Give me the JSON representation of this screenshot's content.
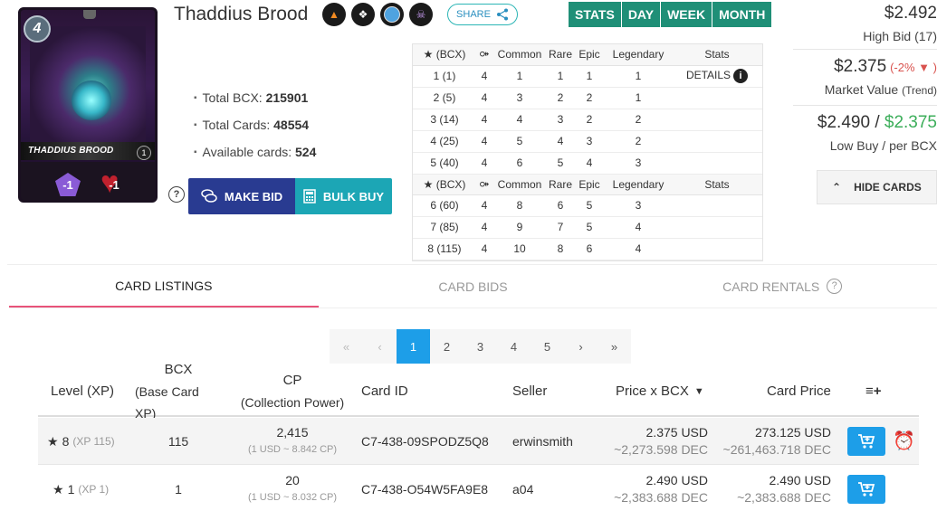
{
  "card": {
    "name": "Thaddius Brood",
    "mana": "4",
    "card_name_banner": "THADDIUS BROOD",
    "level": "1",
    "magic": "-1",
    "health": "-1"
  },
  "share": {
    "label": "SHARE"
  },
  "info": {
    "total_bcx_label": "Total BCX:",
    "total_bcx": "215901",
    "total_cards_label": "Total Cards:",
    "total_cards": "48554",
    "available_label": "Available cards:",
    "available": "524"
  },
  "actions": {
    "make_bid": "MAKE BID",
    "bulk_buy": "BULK BUY",
    "help": "?"
  },
  "level_table": {
    "headers": [
      "(BCX)",
      "Common",
      "Rare",
      "Epic",
      "Legendary",
      "Stats"
    ],
    "details": "DETAILS",
    "rows_a": [
      [
        "1 (1)",
        "4",
        "1",
        "1",
        "1",
        "1"
      ],
      [
        "2 (5)",
        "4",
        "3",
        "2",
        "2",
        "1"
      ],
      [
        "3 (14)",
        "4",
        "4",
        "3",
        "2",
        "2"
      ],
      [
        "4 (25)",
        "4",
        "5",
        "4",
        "3",
        "2"
      ],
      [
        "5 (40)",
        "4",
        "6",
        "5",
        "4",
        "3"
      ]
    ],
    "rows_b": [
      [
        "6 (60)",
        "4",
        "8",
        "6",
        "5",
        "3"
      ],
      [
        "7 (85)",
        "4",
        "9",
        "7",
        "5",
        "4"
      ],
      [
        "8 (115)",
        "4",
        "10",
        "8",
        "6",
        "4"
      ]
    ]
  },
  "period_tabs": [
    "STATS",
    "DAY",
    "WEEK",
    "MONTH"
  ],
  "prices": {
    "high_bid": "$2.492",
    "high_bid_label": "High Bid (17)",
    "market_value": "$2.375",
    "market_change": "(-2%",
    "market_change_end": ")",
    "market_label": "Market Value",
    "market_label_trend": "(Trend)",
    "low_buy": "$2.490",
    "sep": "/",
    "per_bcx": "$2.375",
    "low_label": "Low Buy / per BCX"
  },
  "hide_cards": "HIDE CARDS",
  "tabs": {
    "listings": "CARD LISTINGS",
    "bids": "CARD BIDS",
    "rentals": "CARD RENTALS"
  },
  "pager": [
    "«",
    "‹",
    "1",
    "2",
    "3",
    "4",
    "5",
    "›",
    "»"
  ],
  "listing": {
    "headers": {
      "level": "Level (XP)",
      "bcx": "BCX",
      "bcx_sub": "(Base Card XP)",
      "cp": "CP",
      "cp_sub": "(Collection Power)",
      "card_id": "Card ID",
      "seller": "Seller",
      "price_bcx": "Price x BCX",
      "card_price": "Card Price",
      "menu": "≡+"
    },
    "rows": [
      {
        "level": "8",
        "xp": "(XP 115)",
        "bcx": "115",
        "cp": "2,415",
        "cp_ratio": "(1 USD ~ 8.842 CP)",
        "card_id": "C7-438-09SPODZ5Q8",
        "seller": "erwinsmith",
        "price_usd": "2.375 USD",
        "price_dec": "~2,273.598 DEC",
        "card_usd": "273.125 USD",
        "card_dec": "~261,463.718 DEC"
      },
      {
        "level": "1",
        "xp": "(XP 1)",
        "bcx": "1",
        "cp": "20",
        "cp_ratio": "(1 USD ~ 8.032 CP)",
        "card_id": "C7-438-O54W5FA9E8",
        "seller": "a04",
        "price_usd": "2.490 USD",
        "price_dec": "~2,383.688 DEC",
        "card_usd": "2.490 USD",
        "card_dec": "~2,383.688 DEC"
      }
    ]
  }
}
